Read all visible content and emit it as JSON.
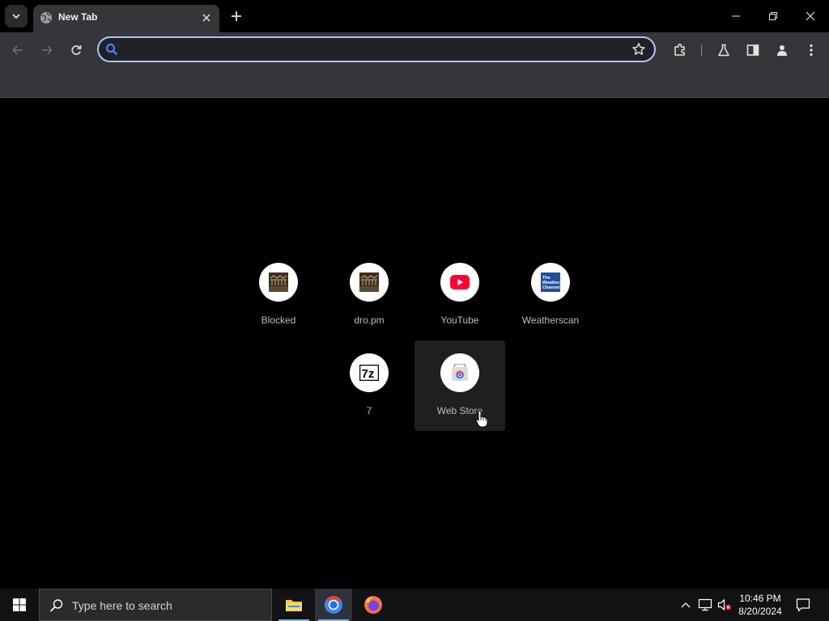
{
  "browser": {
    "tab": {
      "title": "New Tab"
    },
    "omnibox": {
      "value": "",
      "placeholder": ""
    }
  },
  "ntp": {
    "shortcuts": [
      {
        "label": "Blocked"
      },
      {
        "label": "dro.pm"
      },
      {
        "label": "YouTube"
      },
      {
        "label": "Weatherscan"
      },
      {
        "label": "7",
        "icon_text": "7z"
      },
      {
        "label": "Web Store"
      }
    ]
  },
  "weather_icon": {
    "text": "The Weather Channel"
  },
  "taskbar": {
    "search_placeholder": "Type here to search",
    "clock": {
      "time": "10:46 PM",
      "date": "8/20/2024"
    }
  },
  "colors": {
    "accent_focus": "#a8c7fa",
    "youtube_red": "#ff0033",
    "weather_blue": "#1f4e9c"
  }
}
